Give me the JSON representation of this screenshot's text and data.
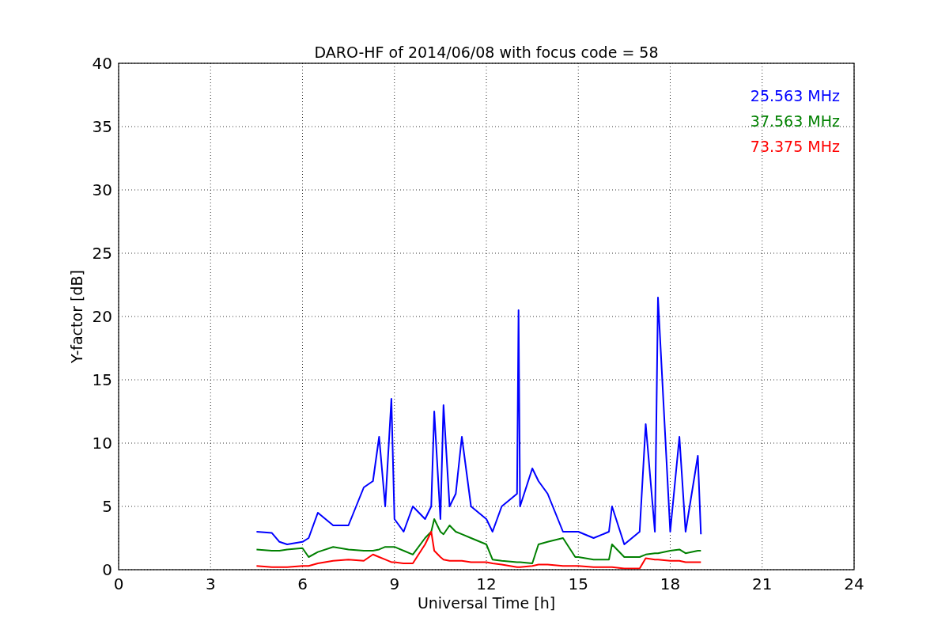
{
  "chart_data": {
    "type": "line",
    "title": "DARO-HF of 2014/06/08 with focus code = 58",
    "xlabel": "Universal Time [h]",
    "ylabel": "Y-factor [dB]",
    "x": [
      4.5,
      5,
      5.25,
      5.5,
      6,
      6.2,
      6.5,
      7,
      7.5,
      8,
      8.3,
      8.5,
      8.7,
      8.9,
      9,
      9.3,
      9.6,
      10,
      10.2,
      10.3,
      10.5,
      10.6,
      10.8,
      11,
      11.2,
      11.5,
      12,
      12.2,
      12.5,
      13,
      13.05,
      13.1,
      13.5,
      13.7,
      14,
      14.5,
      14.9,
      15,
      15.5,
      16,
      16.1,
      16.5,
      17,
      17.2,
      17.5,
      17.6,
      18,
      18.3,
      18.5,
      18.9,
      19
    ],
    "series": [
      {
        "name": "25.563 MHz",
        "color": "#0000ff",
        "values": [
          3,
          2.9,
          2.2,
          2,
          2.2,
          2.5,
          4.5,
          3.5,
          3.5,
          6.5,
          7,
          10.5,
          5,
          13.5,
          4,
          3,
          5,
          4,
          5,
          12.5,
          4,
          13,
          5,
          6,
          10.5,
          5,
          4,
          3,
          5,
          6,
          20.5,
          5,
          8,
          7,
          6,
          3,
          3,
          3,
          2.5,
          3,
          5,
          2,
          3,
          11.5,
          3,
          21.5,
          3,
          10.5,
          3,
          9,
          2.8
        ]
      },
      {
        "name": "37.563 MHz",
        "color": "#008000",
        "values": [
          1.6,
          1.5,
          1.5,
          1.6,
          1.7,
          1,
          1.4,
          1.8,
          1.6,
          1.5,
          1.5,
          1.6,
          1.8,
          1.8,
          1.8,
          1.5,
          1.2,
          2.5,
          3,
          4,
          3,
          2.8,
          3.5,
          3,
          2.8,
          2.5,
          2,
          0.8,
          0.7,
          0.6,
          0.6,
          0.6,
          0.5,
          2,
          2.2,
          2.5,
          1,
          1,
          0.8,
          0.8,
          2,
          1,
          1,
          1.2,
          1.3,
          1.3,
          1.5,
          1.6,
          1.3,
          1.5,
          1.5
        ]
      },
      {
        "name": "73.375 MHz",
        "color": "#ff0000",
        "values": [
          0.3,
          0.2,
          0.2,
          0.2,
          0.3,
          0.3,
          0.5,
          0.7,
          0.8,
          0.7,
          1.2,
          1,
          0.8,
          0.6,
          0.6,
          0.5,
          0.5,
          2,
          3,
          1.5,
          1,
          0.8,
          0.7,
          0.7,
          0.7,
          0.6,
          0.6,
          0.5,
          0.4,
          0.2,
          0.2,
          0.2,
          0.3,
          0.4,
          0.4,
          0.3,
          0.3,
          0.3,
          0.2,
          0.2,
          0.2,
          0.1,
          0.1,
          0.9,
          0.8,
          0.8,
          0.7,
          0.7,
          0.6,
          0.6,
          0.6
        ]
      }
    ],
    "grid": true,
    "xlim": [
      0,
      24
    ],
    "ylim": [
      0,
      40
    ],
    "xticks": [
      0,
      3,
      6,
      9,
      12,
      15,
      18,
      21,
      24
    ],
    "yticks": [
      0,
      5,
      10,
      15,
      20,
      25,
      30,
      35,
      40
    ]
  }
}
